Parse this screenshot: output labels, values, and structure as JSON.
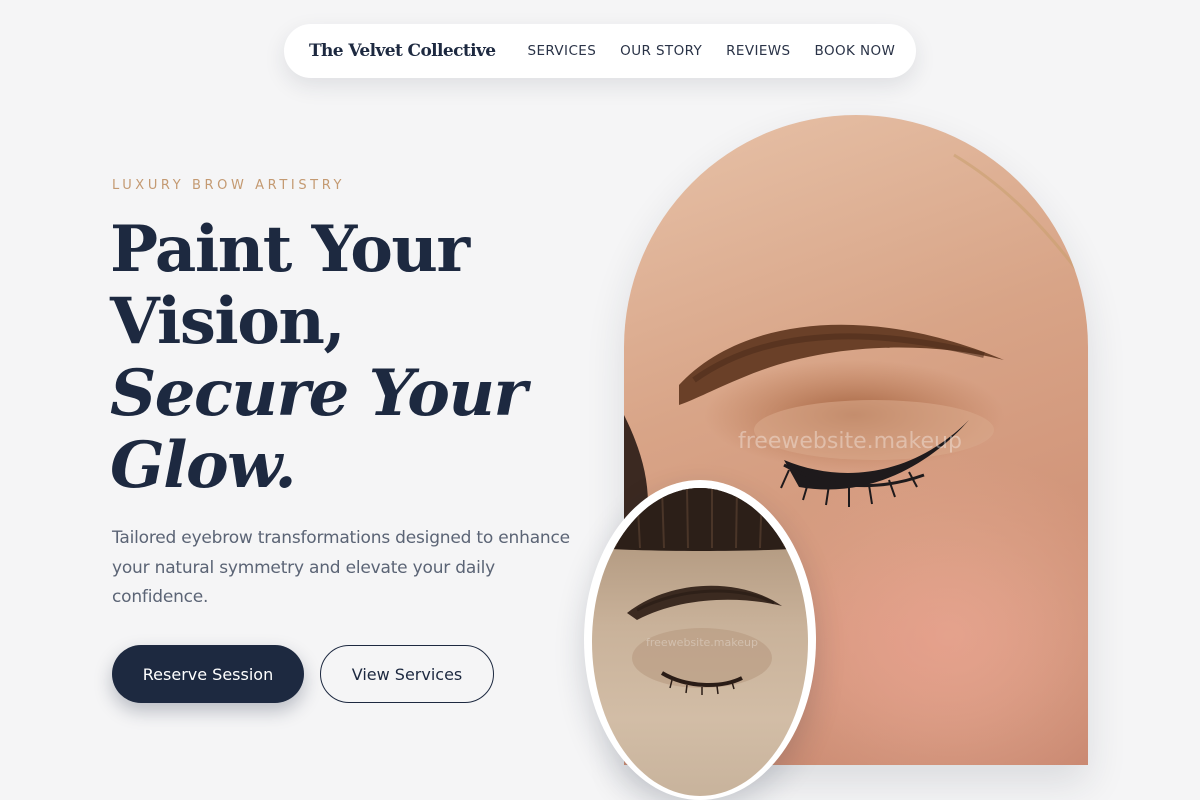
{
  "nav": {
    "brand": "The Velvet Collective",
    "links": [
      "SERVICES",
      "OUR STORY",
      "REVIEWS",
      "BOOK NOW"
    ]
  },
  "hero": {
    "eyebrow": "LUXURY BROW ARTISTRY",
    "headline_line1": "Paint Your",
    "headline_line2": "Vision,",
    "headline_line3": "Secure Your",
    "headline_line4": "Glow.",
    "subtext": "Tailored eyebrow transformations designed to enhance your natural symmetry and elevate your daily confidence.",
    "primary_cta": "Reserve Session",
    "secondary_cta": "View Services"
  },
  "images": {
    "main_watermark": "freewebsite.makeup",
    "inset_watermark": "freewebsite.makeup"
  },
  "colors": {
    "navy": "#1d2940",
    "accent_gold": "#c49a72",
    "background": "#f5f5f6",
    "body_text": "#5b6475"
  }
}
